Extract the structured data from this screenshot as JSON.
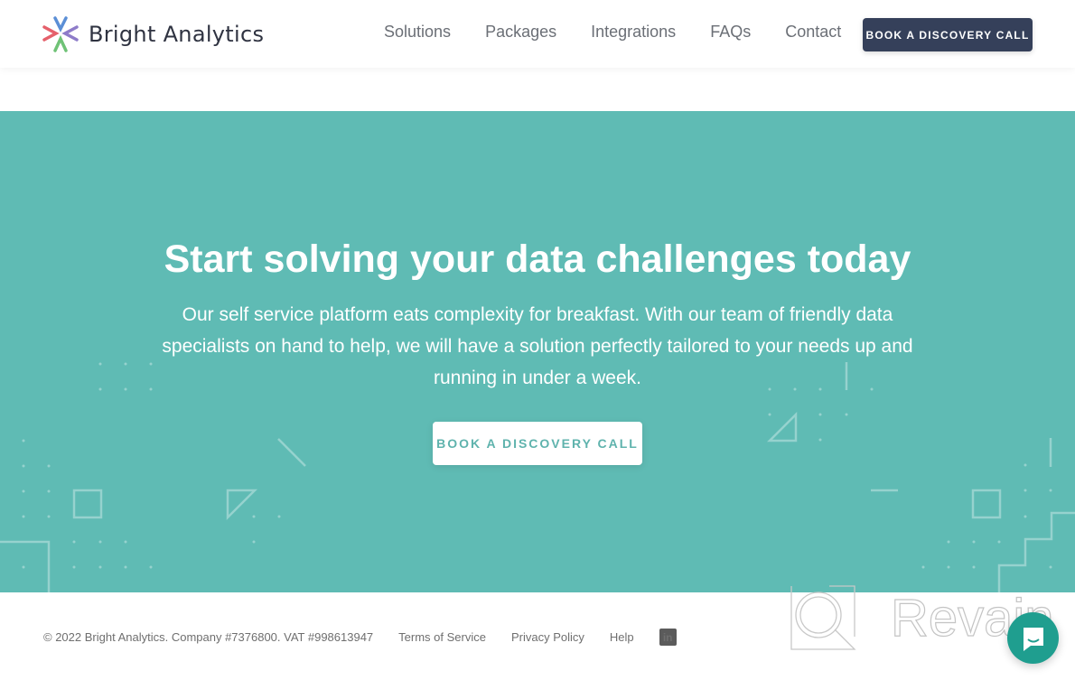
{
  "header": {
    "brand_name": "Bright Analytics",
    "nav": [
      {
        "label": "Solutions"
      },
      {
        "label": "Packages"
      },
      {
        "label": "Integrations"
      },
      {
        "label": "FAQs"
      },
      {
        "label": "Contact"
      }
    ],
    "cta_label": "BOOK A DISCOVERY CALL"
  },
  "hero": {
    "title": "Start solving your data challenges today",
    "text": "Our self service platform eats complexity for breakfast. With our team of friendly data specialists on hand to help, we will have a solution perfectly tailored to your needs up and running in under a week.",
    "cta_label": "BOOK A DISCOVERY CALL",
    "background_color": "#5fbbb4"
  },
  "footer": {
    "copyright": "© 2022 Bright Analytics. Company #7376800. VAT #998613947",
    "links": [
      {
        "label": "Terms of Service"
      },
      {
        "label": "Privacy Policy"
      },
      {
        "label": "Help"
      }
    ],
    "social_icon": "linkedin-icon",
    "social_label": "in"
  },
  "watermark": {
    "text": "Revain"
  },
  "colors": {
    "header_cta_bg": "#35405a",
    "hero_bg": "#5fbbb4",
    "chat_bg": "#1f9e8f"
  }
}
